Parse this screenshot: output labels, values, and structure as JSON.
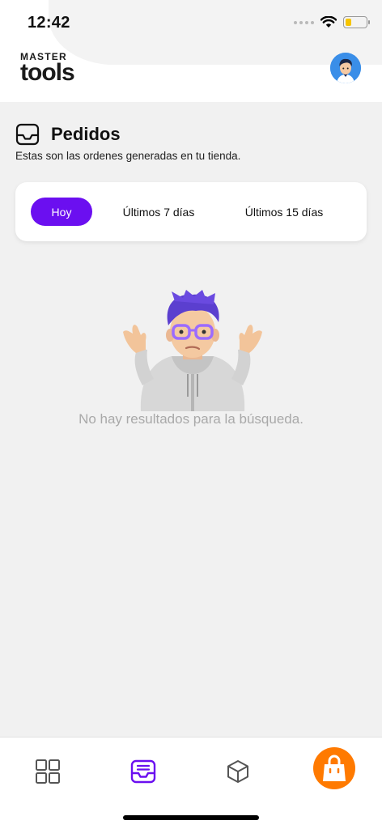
{
  "status_bar": {
    "time": "12:42",
    "battery_level": 0.3
  },
  "header": {
    "logo": {
      "line1": "MASTER",
      "line2": "tools"
    },
    "avatar_icon": "user-avatar-icon"
  },
  "page": {
    "icon": "inbox-icon",
    "title": "Pedidos",
    "subtitle": "Estas son las ordenes generadas en tu tienda."
  },
  "filters": {
    "options": [
      "Hoy",
      "Últimos 7 días",
      "Últimos 15 días"
    ],
    "selected": "Hoy"
  },
  "empty_state": {
    "illustration": "shrugging-memoji",
    "message": "No hay resultados para la búsqueda."
  },
  "tabbar": {
    "items": [
      {
        "icon": "grid-icon",
        "active": false
      },
      {
        "icon": "inbox-icon",
        "active": true
      },
      {
        "icon": "box-icon",
        "active": false
      },
      {
        "icon": "shopping-bag-icon",
        "active": false
      }
    ]
  },
  "colors": {
    "accent": "#6b0ff0",
    "orange": "#ff7a00",
    "background": "#f1f1f1",
    "muted_text": "#a9a9a9"
  }
}
